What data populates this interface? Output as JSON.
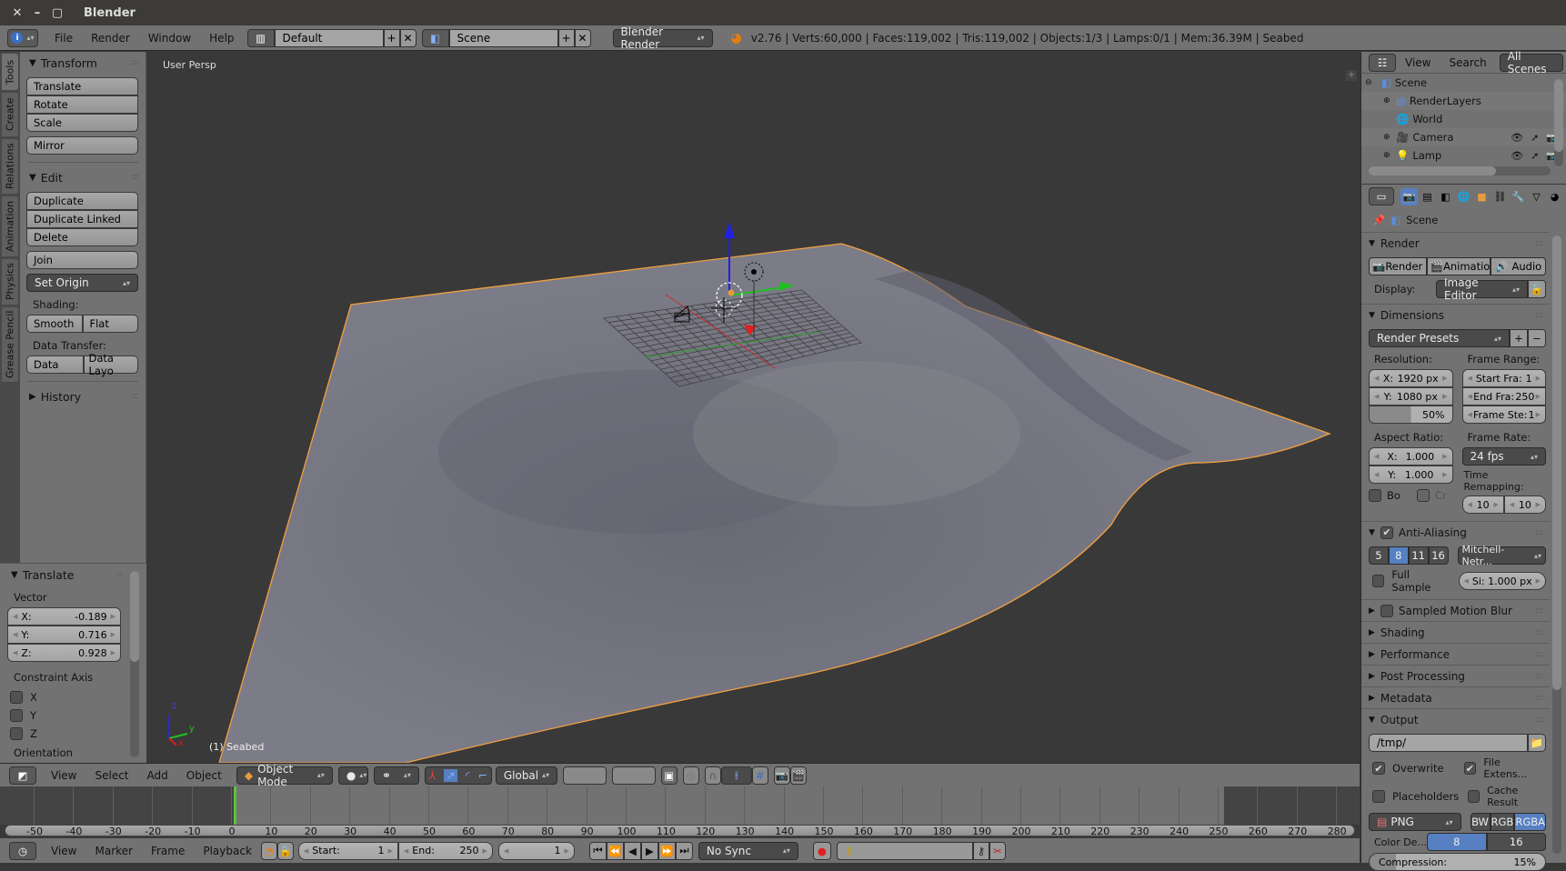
{
  "window": {
    "title": "Blender",
    "controls": [
      "close",
      "minimize",
      "maximize"
    ]
  },
  "info_header": {
    "menus": [
      "File",
      "Render",
      "Window",
      "Help"
    ],
    "layout": "Default",
    "scene": "Scene",
    "engine": "Blender Render",
    "status": "v2.76 | Verts:60,000 | Faces:119,002 | Tris:119,002 | Objects:1/3 | Lamps:0/1 | Mem:36.39M | Seabed"
  },
  "toolshelf": {
    "tabs": [
      "Tools",
      "Create",
      "Relations",
      "Animation",
      "Physics",
      "Grease Pencil"
    ],
    "transform": {
      "title": "Transform",
      "buttons": [
        "Translate",
        "Rotate",
        "Scale"
      ],
      "mirror": "Mirror"
    },
    "edit": {
      "title": "Edit",
      "buttons": [
        "Duplicate",
        "Duplicate Linked",
        "Delete"
      ],
      "join": "Join",
      "set_origin": "Set Origin",
      "shading_label": "Shading:",
      "shading": [
        "Smooth",
        "Flat"
      ],
      "data_transfer_label": "Data Transfer:",
      "data_transfer": [
        "Data",
        "Data Layo"
      ]
    },
    "history": "History"
  },
  "operator_panel": {
    "title": "Translate",
    "vector_label": "Vector",
    "vector": [
      {
        "axis": "X:",
        "value": "-0.189"
      },
      {
        "axis": "Y:",
        "value": "0.716"
      },
      {
        "axis": "Z:",
        "value": "0.928"
      }
    ],
    "constraint_label": "Constraint Axis",
    "constraints": [
      {
        "label": "X",
        "checked": false
      },
      {
        "label": "Y",
        "checked": false
      },
      {
        "label": "Z",
        "checked": false
      }
    ],
    "orientation_label": "Orientation"
  },
  "viewport": {
    "view_label": "User Persp",
    "object_label": "(1) Seabed",
    "axis_labels": {
      "x": "x",
      "y": "y",
      "z": "z"
    },
    "colors": {
      "outline": "#f0a040",
      "x_axis": "#e02020",
      "y_axis": "#20c020",
      "z_axis": "#2020e0"
    }
  },
  "viewport_header": {
    "menus": [
      "View",
      "Select",
      "Add",
      "Object"
    ],
    "mode": "Object Mode",
    "orientation": "Global"
  },
  "timeline": {
    "ticks": [
      "-50",
      "-40",
      "-30",
      "-20",
      "-10",
      "0",
      "10",
      "20",
      "30",
      "40",
      "50",
      "60",
      "70",
      "80",
      "90",
      "100",
      "110",
      "120",
      "130",
      "140",
      "150",
      "160",
      "170",
      "180",
      "190",
      "200",
      "210",
      "220",
      "230",
      "240",
      "250",
      "260",
      "270",
      "280"
    ],
    "current_frame": 1,
    "menus": [
      "View",
      "Marker",
      "Frame",
      "Playback"
    ],
    "start_label": "Start:",
    "start": "1",
    "end_label": "End:",
    "end": "250",
    "frame": "1",
    "sync": "No Sync"
  },
  "outliner": {
    "menus": [
      "View",
      "Search"
    ],
    "filter": "All Scenes",
    "items": [
      {
        "name": "Scene",
        "depth": 0,
        "icon": "scene-icon"
      },
      {
        "name": "RenderLayers",
        "depth": 1,
        "icon": "render-layers-icon"
      },
      {
        "name": "World",
        "depth": 1,
        "icon": "world-icon"
      },
      {
        "name": "Camera",
        "depth": 1,
        "icon": "camera-icon"
      },
      {
        "name": "Lamp",
        "depth": 1,
        "icon": "lamp-icon"
      }
    ]
  },
  "properties": {
    "context": "Scene",
    "render": {
      "title": "Render",
      "buttons": [
        "Render",
        "Animatio",
        "Audio"
      ],
      "display_label": "Display:",
      "display": "Image Editor"
    },
    "dimensions": {
      "title": "Dimensions",
      "presets": "Render Presets",
      "resolution_label": "Resolution:",
      "res_x": {
        "label": "X:",
        "value": "1920 px"
      },
      "res_y": {
        "label": "Y:",
        "value": "1080 px"
      },
      "res_pct": "50%",
      "res_pct_value": 0.5,
      "frame_range_label": "Frame Range:",
      "start": {
        "label": "Start Fra:",
        "value": "1"
      },
      "end": {
        "label": "End Fra:",
        "value": "250"
      },
      "step": {
        "label": "Frame Ste:",
        "value": "1"
      },
      "aspect_label": "Aspect Ratio:",
      "aspect_x": {
        "label": "X:",
        "value": "1.000"
      },
      "aspect_y": {
        "label": "Y:",
        "value": "1.000"
      },
      "frame_rate_label": "Frame Rate:",
      "frame_rate": "24 fps",
      "time_remap_label": "Time Remapping:",
      "remap_old": "10",
      "remap_new": "10",
      "border": "Bo",
      "crop": "Cr"
    },
    "anti_aliasing": {
      "title": "Anti-Aliasing",
      "enabled": true,
      "samples": [
        "5",
        "8",
        "11",
        "16"
      ],
      "selected": "8",
      "filter": "Mitchell-Netr...",
      "full_sample": "Full Sample",
      "size": "Si: 1.000 px"
    },
    "collapsed_sections": [
      "Sampled Motion Blur",
      "Shading",
      "Performance",
      "Post Processing",
      "Metadata"
    ],
    "output": {
      "title": "Output",
      "path": "/tmp/",
      "overwrite": "Overwrite",
      "file_ext": "File Extens...",
      "placeholders": "Placeholders",
      "cache": "Cache Result",
      "format": "PNG",
      "color_modes": [
        "BW",
        "RGB",
        "RGBA"
      ],
      "color_mode": "RGBA",
      "depth_label": "Color De...",
      "depths": [
        "8",
        "16"
      ],
      "depth": "8",
      "compression_label": "Compression:",
      "compression": "15%",
      "compression_value": 0.15
    }
  }
}
